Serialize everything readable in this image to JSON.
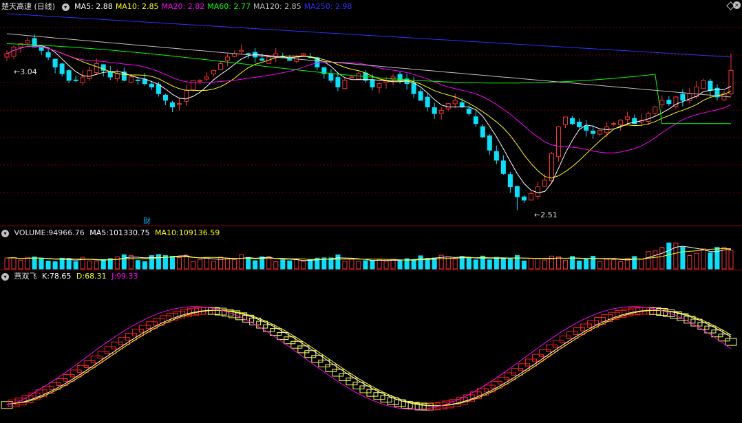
{
  "main": {
    "title": "楚天高速 (日线)",
    "ma": [
      {
        "label": "MA5:",
        "value": "2.88",
        "color": "#ffffff"
      },
      {
        "label": "MA10:",
        "value": "2.85",
        "color": "#ffff00"
      },
      {
        "label": "MA20:",
        "value": "2.82",
        "color": "#ff00ff"
      },
      {
        "label": "MA60:",
        "value": "2.77",
        "color": "#00ff00"
      },
      {
        "label": "MA120:",
        "value": "2.85",
        "color": "#c0c0c0"
      },
      {
        "label": "MA250:",
        "value": "2.98",
        "color": "#3030ff"
      }
    ],
    "high_label": "3.04",
    "low_label": "2.51",
    "cai_label": "财"
  },
  "volume": {
    "label": "VOLUME:",
    "value": "94966.76",
    "ma5_label": "MA5:",
    "ma5": "101330.75",
    "ma10_label": "MA10:",
    "ma10": "109136.59"
  },
  "indicator": {
    "name": "燕双飞",
    "k_label": "K:",
    "k": "78.65",
    "d_label": "D:",
    "d": "68.31",
    "j_label": "J:",
    "j": "99.33"
  },
  "chart_data": {
    "type": "candlestick",
    "price_range": [
      2.51,
      3.04
    ],
    "candles": [
      2.98,
      3.0,
      3.01,
      3.02,
      3.0,
      2.99,
      2.97,
      2.94,
      2.92,
      2.9,
      2.9,
      2.91,
      2.93,
      2.95,
      2.93,
      2.91,
      2.92,
      2.9,
      2.91,
      2.9,
      2.89,
      2.88,
      2.86,
      2.84,
      2.82,
      2.83,
      2.87,
      2.9,
      2.9,
      2.91,
      2.93,
      2.95,
      2.97,
      2.98,
      2.99,
      2.98,
      2.97,
      2.96,
      2.97,
      2.98,
      2.97,
      2.96,
      2.97,
      2.98,
      2.97,
      2.94,
      2.92,
      2.9,
      2.88,
      2.9,
      2.91,
      2.92,
      2.9,
      2.88,
      2.89,
      2.9,
      2.91,
      2.9,
      2.89,
      2.86,
      2.84,
      2.82,
      2.8,
      2.81,
      2.83,
      2.84,
      2.82,
      2.8,
      2.77,
      2.73,
      2.69,
      2.66,
      2.62,
      2.58,
      2.55,
      2.54,
      2.56,
      2.58,
      2.6,
      2.68,
      2.76,
      2.79,
      2.77,
      2.76,
      2.75,
      2.74,
      2.75,
      2.76,
      2.77,
      2.78,
      2.79,
      2.77,
      2.78,
      2.8,
      2.82,
      2.84,
      2.83,
      2.85,
      2.84,
      2.86,
      2.88,
      2.9,
      2.87,
      2.85,
      2.86,
      2.93
    ]
  }
}
